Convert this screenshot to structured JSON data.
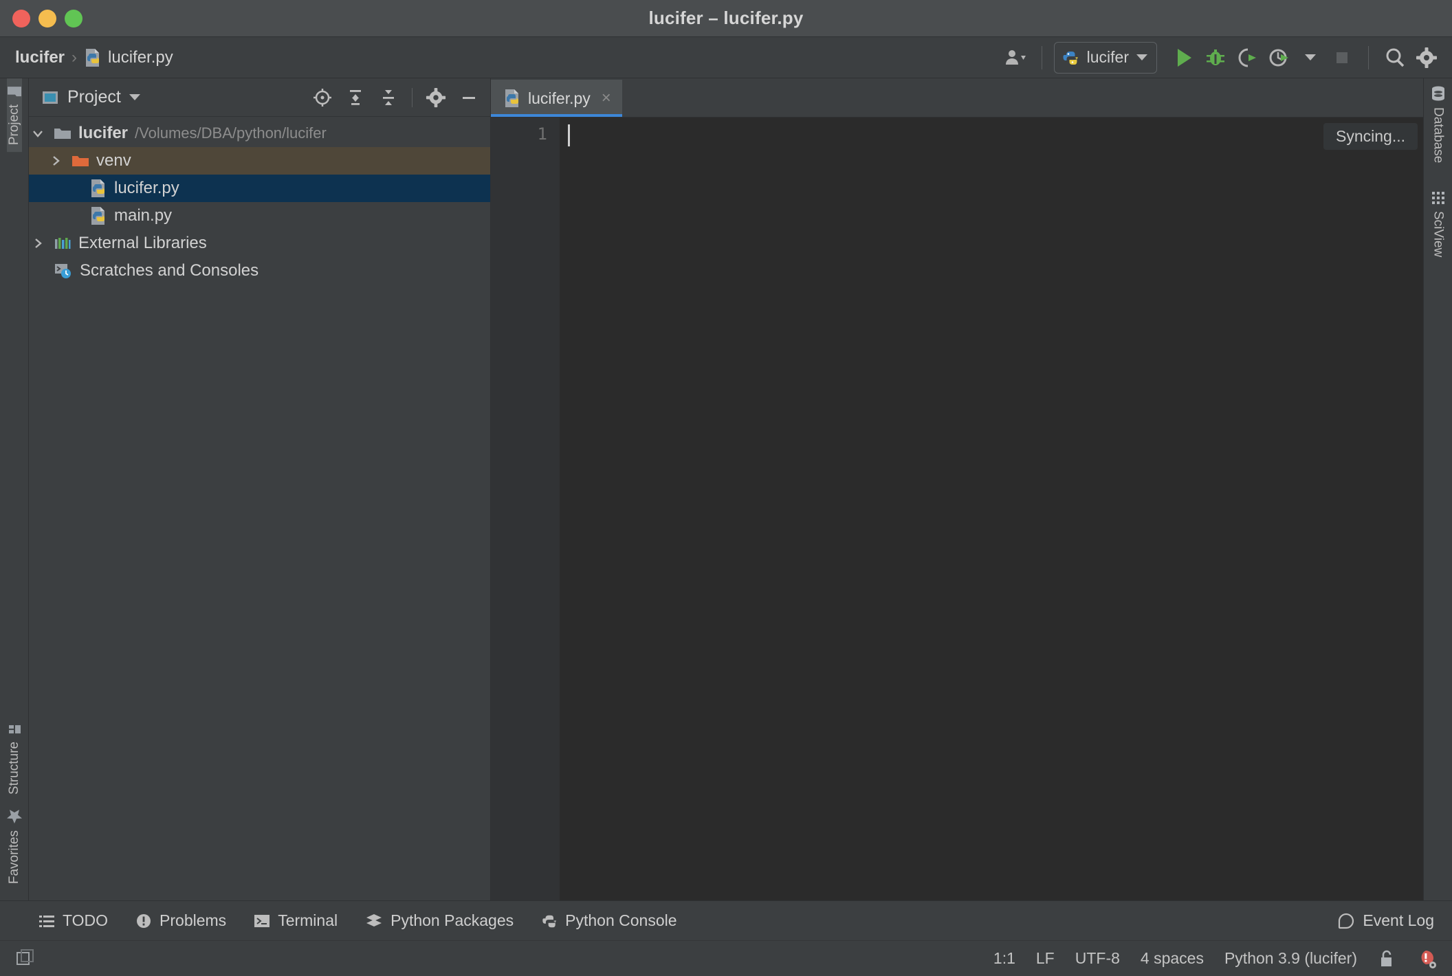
{
  "window": {
    "title": "lucifer – lucifer.py",
    "controls": [
      "close",
      "minimize",
      "maximize"
    ]
  },
  "navbar": {
    "breadcrumbs": [
      {
        "label": "lucifer",
        "icon": "project-icon",
        "bold": true
      },
      {
        "label": "lucifer.py",
        "icon": "python-file-icon",
        "bold": false
      }
    ],
    "account_icon": "user-account-icon",
    "run_config": {
      "label": "lucifer",
      "icon": "python-icon"
    },
    "actions": [
      {
        "name": "run-button",
        "icon": "play-icon",
        "color": "#5fad4e"
      },
      {
        "name": "debug-button",
        "icon": "bug-icon",
        "color": "#5fad4e"
      },
      {
        "name": "run-coverage-button",
        "icon": "coverage-icon"
      },
      {
        "name": "profile-button",
        "icon": "profiler-icon"
      },
      {
        "name": "stop-button",
        "icon": "stop-icon"
      },
      {
        "name": "search-button",
        "icon": "search-icon"
      },
      {
        "name": "settings-button",
        "icon": "gear-icon"
      }
    ]
  },
  "left_stripe": {
    "top": [
      {
        "label": "Project",
        "icon": "folder-icon",
        "selected": true
      }
    ],
    "bottom": [
      {
        "label": "Structure",
        "icon": "structure-icon"
      },
      {
        "label": "Favorites",
        "icon": "star-icon"
      }
    ]
  },
  "right_stripe": {
    "items": [
      {
        "label": "Database",
        "icon": "database-icon"
      },
      {
        "label": "SciView",
        "icon": "grid-icon"
      }
    ]
  },
  "project_panel": {
    "title": "Project",
    "title_icon": "project-view-icon",
    "tools": [
      {
        "name": "select-opened-file-button",
        "icon": "locate-icon"
      },
      {
        "name": "expand-all-button",
        "icon": "expand-all-icon"
      },
      {
        "name": "collapse-all-button",
        "icon": "collapse-all-icon"
      },
      {
        "name": "panel-settings-button",
        "icon": "gear-icon"
      },
      {
        "name": "hide-panel-button",
        "icon": "minimize-icon"
      }
    ],
    "tree": [
      {
        "label": "lucifer",
        "path": "/Volumes/DBA/python/lucifer",
        "icon": "folder-icon",
        "indent": 0,
        "arrow": "down",
        "bold": true,
        "state": "normal"
      },
      {
        "label": "venv",
        "path": "",
        "icon": "excluded-folder-icon",
        "indent": 1,
        "arrow": "right",
        "bold": false,
        "state": "excluded"
      },
      {
        "label": "lucifer.py",
        "path": "",
        "icon": "python-file-icon",
        "indent": 2,
        "arrow": "none",
        "bold": false,
        "state": "selected"
      },
      {
        "label": "main.py",
        "path": "",
        "icon": "python-file-icon",
        "indent": 2,
        "arrow": "none",
        "bold": false,
        "state": "normal"
      },
      {
        "label": "External Libraries",
        "path": "",
        "icon": "libraries-icon",
        "indent": 0,
        "arrow": "right",
        "bold": false,
        "state": "normal"
      },
      {
        "label": "Scratches and Consoles",
        "path": "",
        "icon": "scratches-icon",
        "indent": 0,
        "arrow": "none",
        "bold": false,
        "state": "normal"
      }
    ]
  },
  "editor": {
    "tabs": [
      {
        "label": "lucifer.py",
        "icon": "python-file-icon",
        "active": true,
        "close_glyph": "×"
      }
    ],
    "line_numbers": [
      "1"
    ],
    "content": "",
    "notification": "Syncing..."
  },
  "bottom_toolwindows": [
    {
      "label": "TODO",
      "icon": "todo-icon"
    },
    {
      "label": "Problems",
      "icon": "problems-icon"
    },
    {
      "label": "Terminal",
      "icon": "terminal-icon"
    },
    {
      "label": "Python Packages",
      "icon": "packages-icon"
    },
    {
      "label": "Python Console",
      "icon": "python-console-icon"
    }
  ],
  "event_log": {
    "label": "Event Log",
    "icon": "event-log-icon"
  },
  "statusbar": {
    "layout_icon": "tool-windows-icon",
    "caret_position": "1:1",
    "line_separator": "LF",
    "encoding": "UTF-8",
    "indent": "4 spaces",
    "interpreter": "Python 3.9 (lucifer)",
    "lock_icon": "unlock-icon",
    "inspection_icon": "inspection-warning-icon"
  },
  "colors": {
    "titlebar": "#4a4d4f",
    "chrome": "#3c3f41",
    "editor_bg": "#2b2b2b",
    "gutter": "#313335",
    "selection": "#0d3250",
    "excluded": "#4f4739",
    "tab_active": "#4e5254",
    "tab_underline": "#3d87d8",
    "accent_green": "#5fad4e",
    "text": "#d2d2d2",
    "text_dim": "#8d8d8d"
  }
}
